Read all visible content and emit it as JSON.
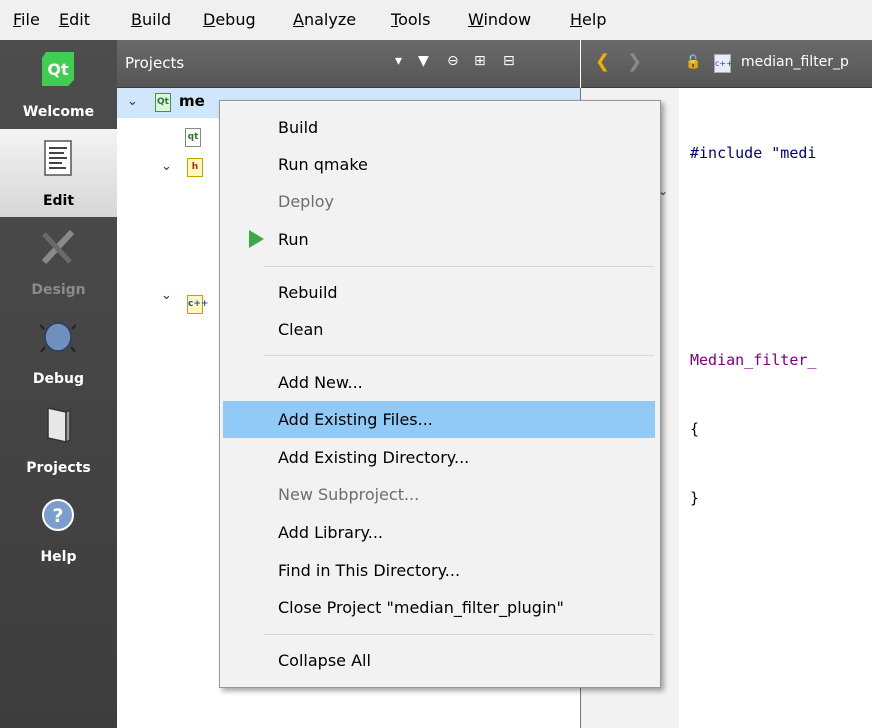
{
  "menubar": {
    "items": [
      {
        "label": "File",
        "mnemonic": "F",
        "rest": "ile"
      },
      {
        "label": "Edit",
        "mnemonic": "E",
        "rest": "dit"
      },
      {
        "label": "Build",
        "mnemonic": "B",
        "rest": "uild"
      },
      {
        "label": "Debug",
        "mnemonic": "D",
        "rest": "ebug"
      },
      {
        "label": "Analyze",
        "mnemonic": "A",
        "rest": "nalyze"
      },
      {
        "label": "Tools",
        "mnemonic": "T",
        "rest": "ools"
      },
      {
        "label": "Window",
        "mnemonic": "W",
        "rest": "indow"
      },
      {
        "label": "Help",
        "mnemonic": "H",
        "rest": "elp"
      }
    ]
  },
  "modes": {
    "welcome": "Welcome",
    "edit": "Edit",
    "design": "Design",
    "debug": "Debug",
    "projects": "Projects",
    "help": "Help"
  },
  "navigation": {
    "title": "Projects",
    "project_name_visible": "me"
  },
  "editor": {
    "file_tab": "median_filter_p",
    "code_lines": [
      "#include \"medi",
      "",
      "",
      "Median_filter_",
      "{",
      "}"
    ]
  },
  "context_menu": {
    "items": [
      {
        "label": "Build",
        "enabled": true
      },
      {
        "label": "Run qmake",
        "enabled": true
      },
      {
        "label": "Deploy",
        "enabled": false
      },
      {
        "label": "Run",
        "enabled": true
      },
      {
        "label": "Rebuild",
        "enabled": true
      },
      {
        "label": "Clean",
        "enabled": true
      },
      {
        "label": "Add New...",
        "enabled": true
      },
      {
        "label": "Add Existing Files...",
        "enabled": true,
        "highlighted": true
      },
      {
        "label": "Add Existing Directory...",
        "enabled": true
      },
      {
        "label": "New Subproject...",
        "enabled": false
      },
      {
        "label": "Add Library...",
        "enabled": true
      },
      {
        "label": "Find in This Directory...",
        "enabled": true
      },
      {
        "label": "Close Project \"median_filter_plugin\"",
        "enabled": true
      },
      {
        "label": "Collapse All",
        "enabled": true
      }
    ]
  },
  "colors": {
    "highlight": "#91c9f7",
    "run_icon": "#3ca846",
    "menu_bg": "#f2f2f2",
    "modebar_bg": "#444444",
    "include_string": "#008000",
    "class_name": "#800080"
  }
}
